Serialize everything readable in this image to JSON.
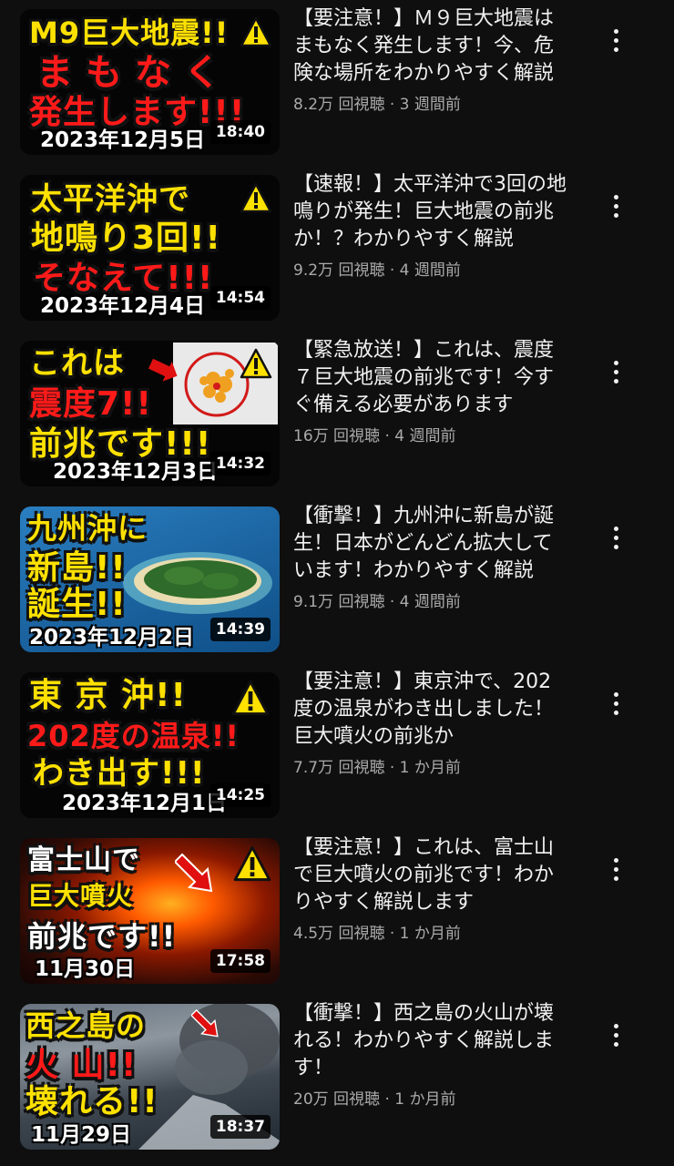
{
  "videos": [
    {
      "title": "【要注意！】Ｍ９巨大地震はまもなく発生します！今、危険な場所をわかりやすく解説",
      "views": "8.2万 回視聴",
      "age": "3 週間前",
      "duration": "18:40",
      "thumb_captions": [
        "M9巨大地震!!",
        "まもなく",
        "発生します!!!"
      ],
      "thumb_date": "2023年12月5日"
    },
    {
      "title": "【速報！】太平洋沖で3回の地鳴りが発生！巨大地震の前兆か！？わかりやすく解説",
      "views": "9.2万 回視聴",
      "age": "4 週間前",
      "duration": "14:54",
      "thumb_captions": [
        "太平洋沖で",
        "地鳴り3回!!",
        "そなえて!!!"
      ],
      "thumb_date": "2023年12月4日"
    },
    {
      "title": "【緊急放送！】これは、震度７巨大地震の前兆です！今すぐ備える必要があります",
      "views": "16万 回視聴",
      "age": "4 週間前",
      "duration": "14:32",
      "thumb_captions": [
        "これは",
        "震度7!!",
        "前兆です!!!"
      ],
      "thumb_date": "2023年12月3日"
    },
    {
      "title": "【衝撃！】九州沖に新島が誕生！日本がどんどん拡大しています！わかりやすく解説",
      "views": "9.1万 回視聴",
      "age": "4 週間前",
      "duration": "14:39",
      "thumb_captions": [
        "九州沖に",
        "新島!!",
        "誕生!!"
      ],
      "thumb_date": "2023年12月2日"
    },
    {
      "title": "【要注意！】東京沖で、202度の温泉がわき出しました！巨大噴火の前兆か",
      "views": "7.7万 回視聴",
      "age": "1 か月前",
      "duration": "14:25",
      "thumb_captions": [
        "東 京 沖!!",
        "202度の温泉!!",
        "わき出す!!!"
      ],
      "thumb_date": "2023年12月1日"
    },
    {
      "title": "【要注意！】これは、富士山で巨大噴火の前兆です！わかりやすく解説します",
      "views": "4.5万 回視聴",
      "age": "1 か月前",
      "duration": "17:58",
      "thumb_captions": [
        "富士山で",
        "巨大噴火",
        "前兆です!!"
      ],
      "thumb_date": "11月30日"
    },
    {
      "title": "【衝撃！】西之島の火山が壊れる！わかりやすく解説します！",
      "views": "20万 回視聴",
      "age": "1 か月前",
      "duration": "18:37",
      "thumb_captions": [
        "西之島の",
        "火 山!!",
        "壊れる!!"
      ],
      "thumb_date": "11月29日"
    }
  ],
  "meta_separator": " · ",
  "icons": {
    "menu": "more-vert-icon",
    "warning": "warning-triangle-icon"
  },
  "colors": {
    "background": "#0f0f0f",
    "title_text": "#f1f1f1",
    "meta_text": "#aaaaaa",
    "caption_yellow": "#ffe100",
    "caption_red": "#ff1a1a",
    "caption_white": "#ffffff"
  }
}
